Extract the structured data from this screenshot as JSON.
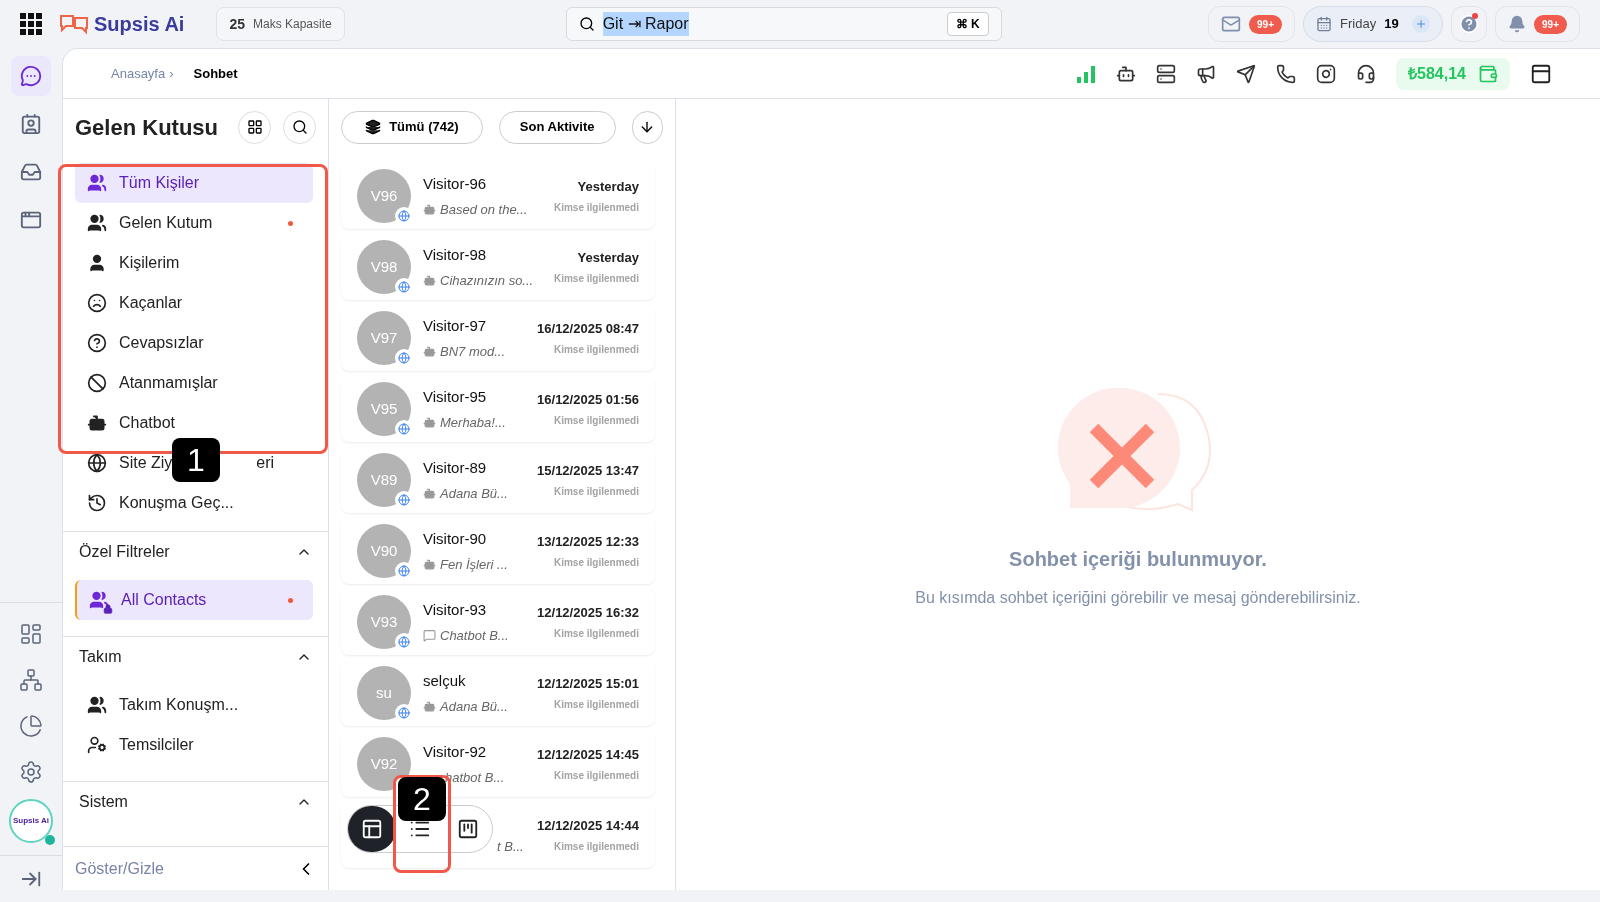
{
  "topbar": {
    "brand": "Supsis Ai",
    "capacity": {
      "value": "25",
      "label": "Maks Kapasite"
    },
    "search": {
      "value": "Git ⇥ Rapor",
      "shortcut": "⌘ K"
    },
    "mail_badge": "99+",
    "date": {
      "day": "Friday",
      "number": "19"
    },
    "help_dot": true,
    "notify_badge": "99+"
  },
  "rail": {
    "top": [
      {
        "selected": true
      },
      {
        "selected": false
      },
      {
        "selected": false
      },
      {
        "selected": false
      }
    ],
    "avatar_label": "Supsis Ai"
  },
  "breadcrumb": {
    "link": "Anasayfa",
    "separator": "›",
    "current": "Sohbet"
  },
  "balance": "₺584,14",
  "sidebar": {
    "title": "Gelen Kutusu",
    "items": [
      {
        "label": "Tüm Kişiler",
        "selected": true,
        "dot": false
      },
      {
        "label": "Gelen Kutum",
        "selected": false,
        "dot": true
      },
      {
        "label": "Kişilerim",
        "selected": false,
        "dot": false
      },
      {
        "label": "Kaçanlar",
        "selected": false,
        "dot": false
      },
      {
        "label": "Cevapsızlar",
        "selected": false,
        "dot": false
      },
      {
        "label": "Atanmamışlar",
        "selected": false,
        "dot": false
      },
      {
        "label": "Chatbot",
        "selected": false,
        "dot": false
      },
      {
        "label": "Site Ziy",
        "label_tail": "eri",
        "selected": false,
        "dot": false
      },
      {
        "label": "Konuşma Geç...",
        "selected": false,
        "dot": false
      }
    ],
    "sections": [
      {
        "title": "Özel Filtreler",
        "expanded": true,
        "items": [
          {
            "label": "All Contacts",
            "selected": true,
            "dot": true
          }
        ]
      },
      {
        "title": "Takım",
        "expanded": true,
        "items": [
          {
            "label": "Takım Konuşm...",
            "selected": false,
            "dot": false
          },
          {
            "label": "Temsilciler",
            "selected": false,
            "dot": false
          }
        ]
      },
      {
        "title": "Sistem",
        "expanded": true
      }
    ],
    "toggle": "Göster/Gizle"
  },
  "list": {
    "filter": "Tümü (742)",
    "sort": "Son Aktivite",
    "conversations": [
      {
        "initials": "V96",
        "name": "Visitor-96",
        "preview": "Based on the...",
        "kind": "bot",
        "time": "Yesterday",
        "status": "Kimse ilgilenmedi"
      },
      {
        "initials": "V98",
        "name": "Visitor-98",
        "preview": "Cihazınızın so...",
        "kind": "bot",
        "time": "Yesterday",
        "status": "Kimse ilgilenmedi"
      },
      {
        "initials": "V97",
        "name": "Visitor-97",
        "preview": "BN7 mod...",
        "kind": "bot",
        "time": "16/12/2025 08:47",
        "status": "Kimse ilgilenmedi"
      },
      {
        "initials": "V95",
        "name": "Visitor-95",
        "preview": "Merhaba!...",
        "kind": "bot",
        "time": "16/12/2025 01:56",
        "status": "Kimse ilgilenmedi"
      },
      {
        "initials": "V89",
        "name": "Visitor-89",
        "preview": "Adana Bü...",
        "kind": "bot",
        "time": "15/12/2025 13:47",
        "status": "Kimse ilgilenmedi"
      },
      {
        "initials": "V90",
        "name": "Visitor-90",
        "preview": "Fen İşleri ...",
        "kind": "bot",
        "time": "13/12/2025 12:33",
        "status": "Kimse ilgilenmedi"
      },
      {
        "initials": "V93",
        "name": "Visitor-93",
        "preview": "Chatbot B...",
        "kind": "chat",
        "time": "12/12/2025 16:32",
        "status": "Kimse ilgilenmedi"
      },
      {
        "initials": "su",
        "name": "selçuk",
        "preview": "Adana Bü...",
        "kind": "bot",
        "time": "12/12/2025 15:01",
        "status": "Kimse ilgilenmedi"
      },
      {
        "initials": "V92",
        "name": "Visitor-92",
        "preview": "hatbot B...",
        "kind": "covered",
        "time": "12/12/2025 14:45",
        "status": "Kimse ilgilenmedi"
      },
      {
        "preview": "t B...",
        "kind": "covered",
        "time": "12/12/2025 14:44",
        "status": "Kimse ilgilenmedi"
      }
    ]
  },
  "view_toggle": [
    {
      "selected": true
    },
    {
      "selected": false
    },
    {
      "selected": false
    }
  ],
  "empty": {
    "title": "Sohbet içeriği bulunmuyor.",
    "text": "Bu kısımda sohbet içeriğini görebilir ve mesaj gönderebilirsiniz."
  },
  "callouts": [
    "1",
    "2"
  ]
}
